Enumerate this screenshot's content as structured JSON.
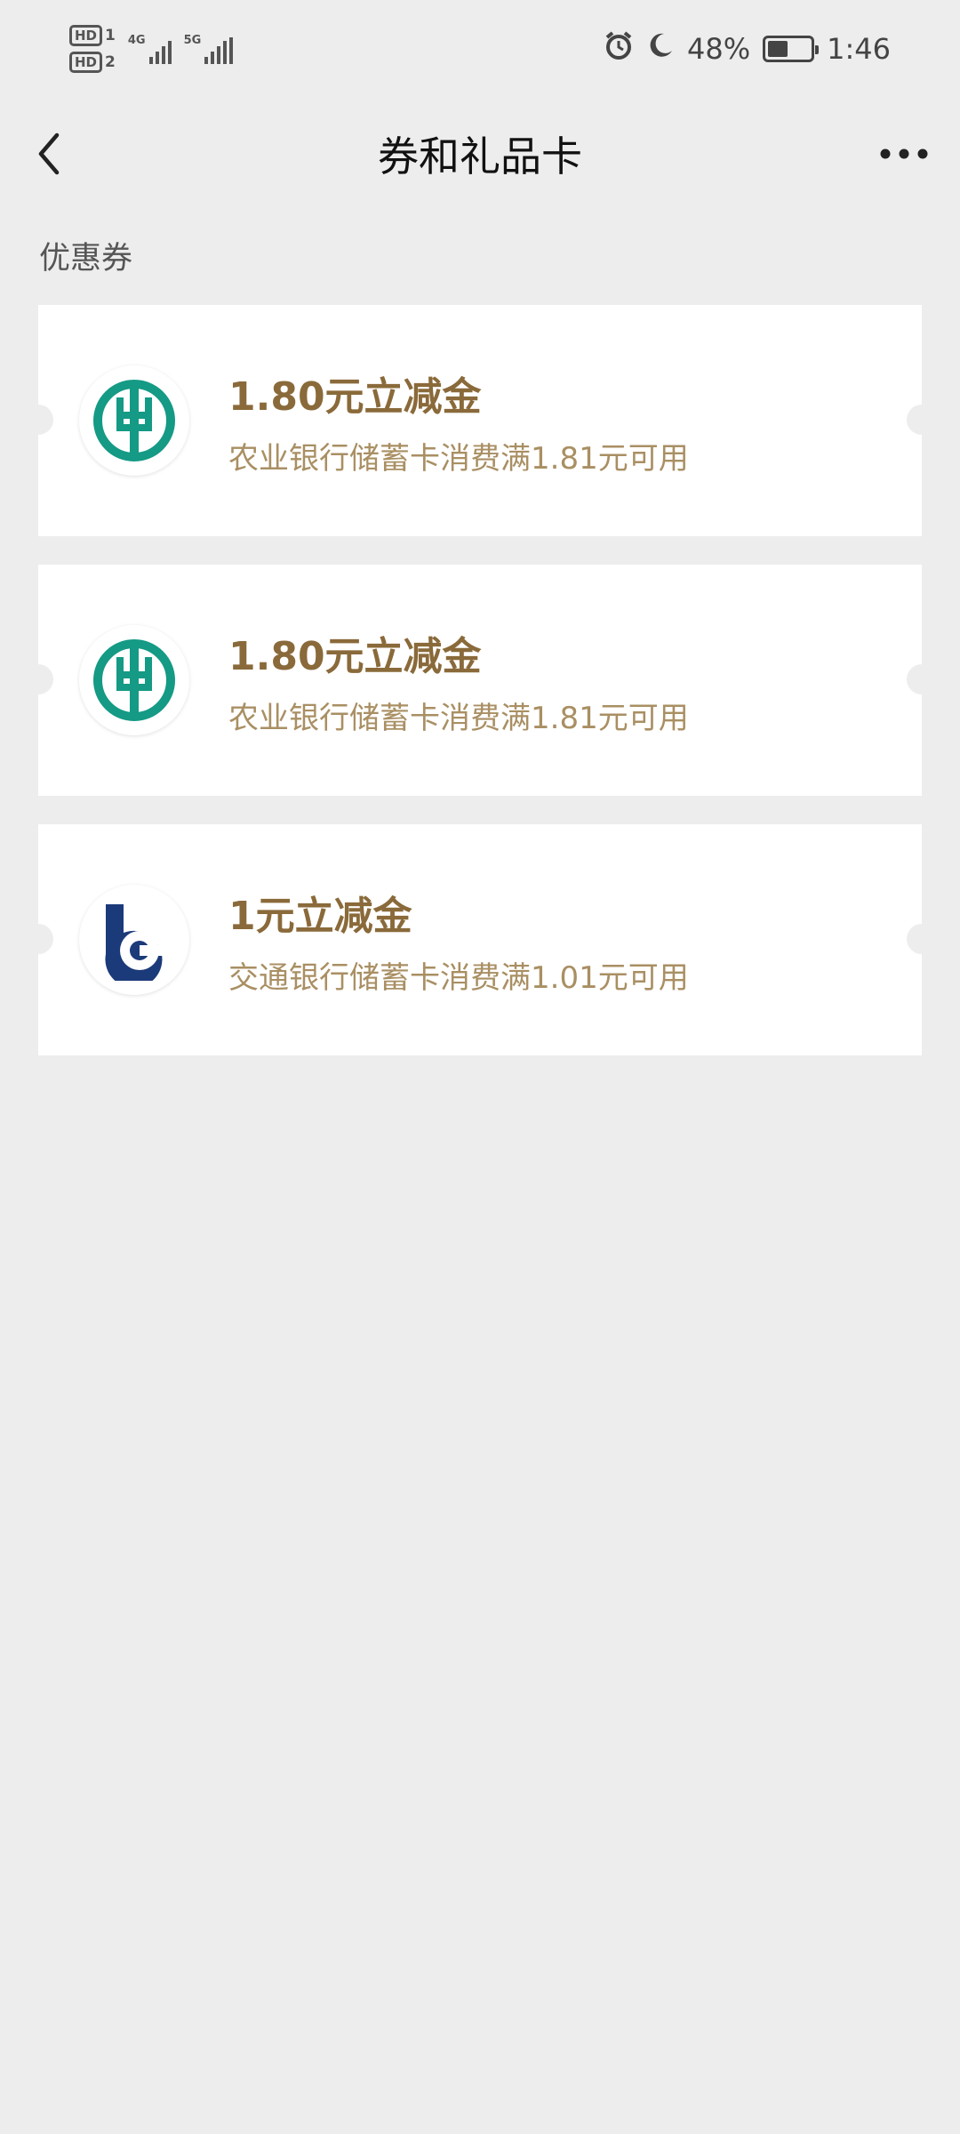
{
  "status_bar": {
    "hd1": "HD",
    "hd1_sub": "1",
    "hd2": "HD",
    "hd2_sub": "2",
    "net1": "4G",
    "net2": "5G",
    "battery_percent": "48%",
    "battery_level": 0.48,
    "time": "1:46",
    "icons": [
      "alarm-icon",
      "moon-icon",
      "battery-icon"
    ]
  },
  "nav": {
    "title": "券和礼品卡",
    "back_icon": "chevron-left-icon",
    "more_icon": "more-horizontal-icon"
  },
  "section": {
    "label": "优惠券"
  },
  "coupons": [
    {
      "title": "1.80元立减金",
      "desc": "农业银行储蓄卡消费满1.81元可用",
      "logo": "abc-bank-logo",
      "logo_color": "#149a85"
    },
    {
      "title": "1.80元立减金",
      "desc": "农业银行储蓄卡消费满1.81元可用",
      "logo": "abc-bank-logo",
      "logo_color": "#149a85"
    },
    {
      "title": "1元立减金",
      "desc": "交通银行储蓄卡消费满1.01元可用",
      "logo": "bocom-bank-logo",
      "logo_color": "#1b3a7a"
    }
  ],
  "colors": {
    "background": "#ededed",
    "coupon_title": "#8a6a3a",
    "coupon_desc": "#a98f63"
  }
}
